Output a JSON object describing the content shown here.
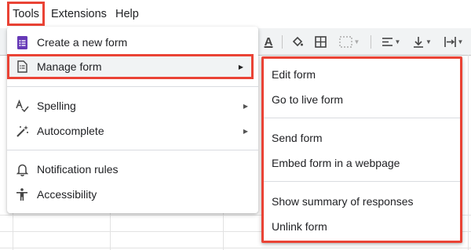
{
  "menubar": {
    "tools": "Tools",
    "extensions": "Extensions",
    "help": "Help"
  },
  "toolbar": {
    "text_color_glyph": "A"
  },
  "tools_menu": {
    "items": [
      {
        "label": "Create a new form",
        "icon": "forms-icon"
      },
      {
        "label": "Manage form",
        "icon": "manage-form-icon",
        "has_submenu": true,
        "selected": true
      },
      {
        "label": "Spelling",
        "icon": "spelling-icon",
        "has_submenu": true
      },
      {
        "label": "Autocomplete",
        "icon": "autocomplete-icon",
        "has_submenu": true
      },
      {
        "label": "Notification rules",
        "icon": "bell-icon"
      },
      {
        "label": "Accessibility",
        "icon": "accessibility-icon"
      }
    ]
  },
  "manage_form_submenu": {
    "items": [
      {
        "label": "Edit form"
      },
      {
        "label": "Go to live form"
      },
      {
        "label": "Send form"
      },
      {
        "label": "Embed form in a webpage"
      },
      {
        "label": "Show summary of responses"
      },
      {
        "label": "Unlink form"
      }
    ]
  },
  "colors": {
    "highlight_border": "#ea4335",
    "forms_purple": "#673ab7",
    "hover_bg": "#f1f3f4"
  }
}
